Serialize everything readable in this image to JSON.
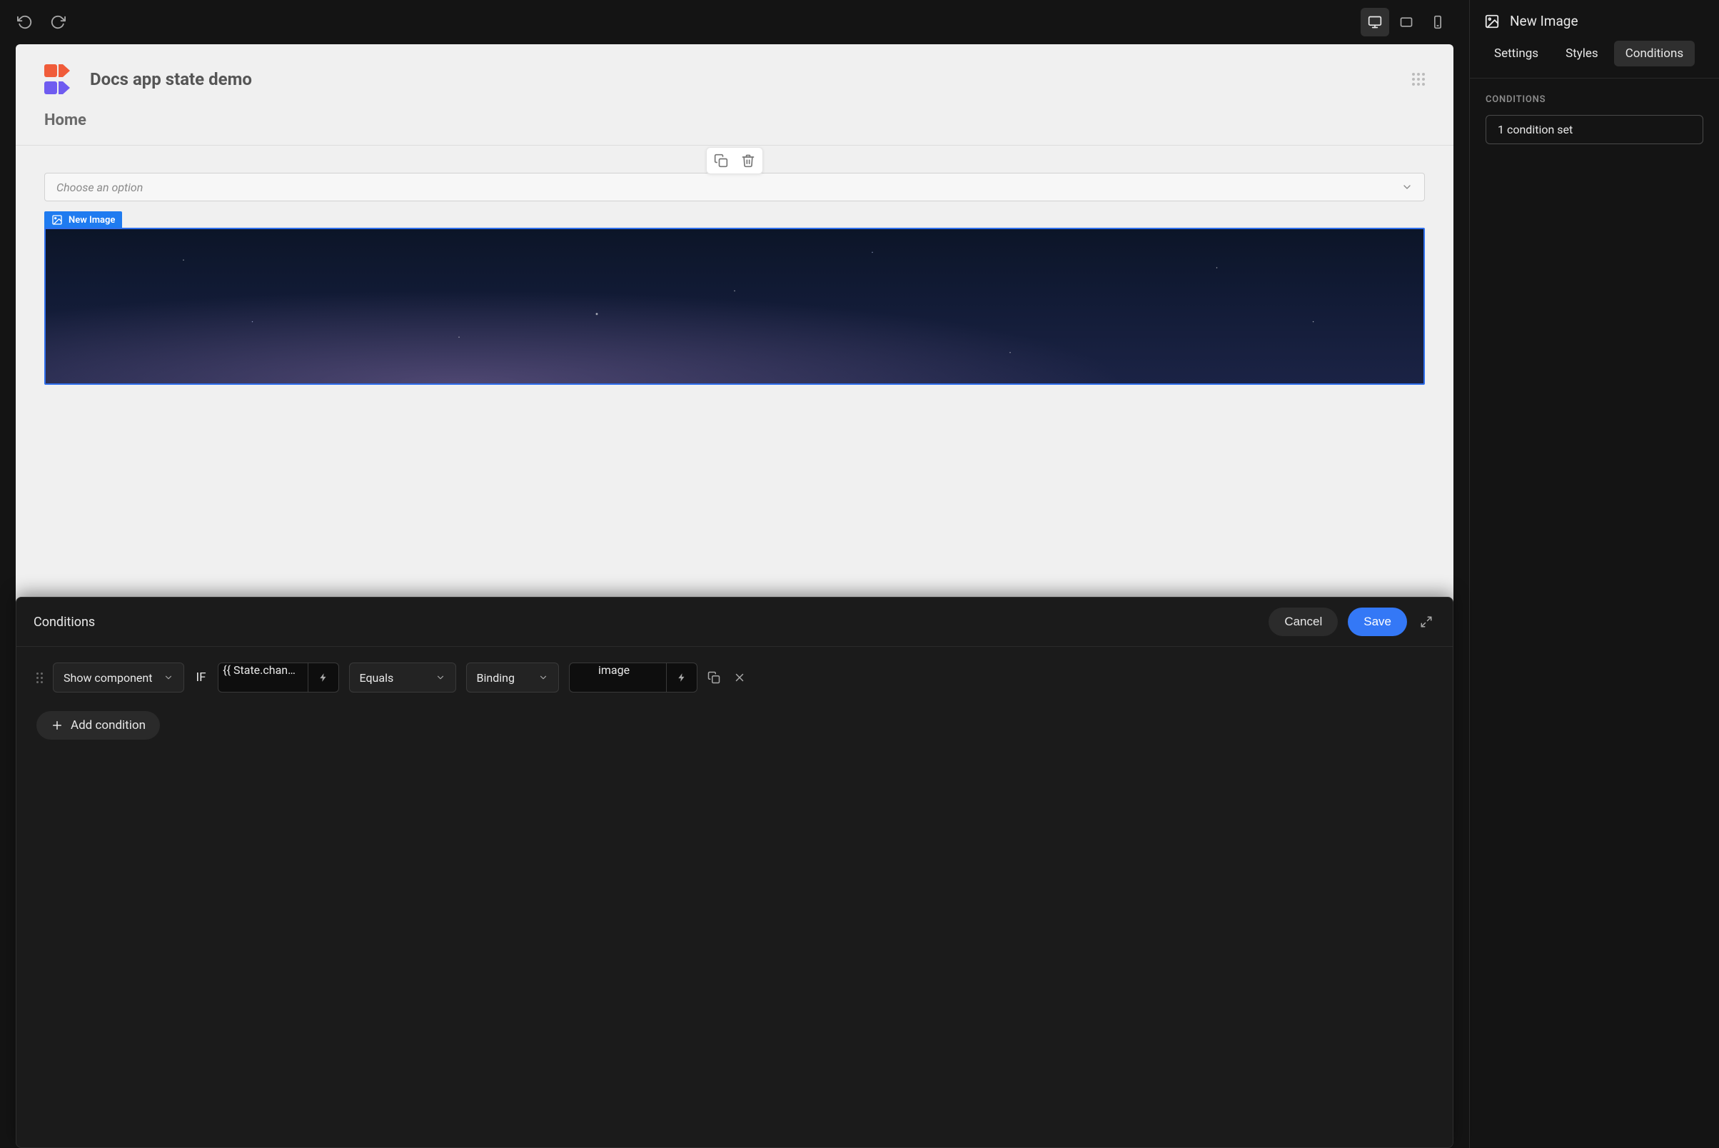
{
  "topbar": {
    "undo_icon": "undo",
    "redo_icon": "redo",
    "devices": [
      "desktop",
      "tablet",
      "mobile"
    ],
    "active_device": "desktop"
  },
  "canvas": {
    "app_title": "Docs app state demo",
    "subhead": "Home",
    "select_placeholder": "Choose an option",
    "component_badge": "New Image",
    "float": {
      "duplicate": "duplicate",
      "delete": "delete"
    }
  },
  "conditions_panel": {
    "title": "Conditions",
    "cancel": "Cancel",
    "save": "Save",
    "row": {
      "action": "Show component",
      "if": "IF",
      "left_value": "{{ State.chan…",
      "operator": "Equals",
      "compare_mode": "Binding",
      "right_value": "image"
    },
    "add_condition": "Add condition"
  },
  "sidebar": {
    "element_name": "New Image",
    "tabs": {
      "settings": "Settings",
      "styles": "Styles",
      "conditions": "Conditions"
    },
    "active_tab": "conditions",
    "section_label": "CONDITIONS",
    "chip": "1 condition set"
  }
}
